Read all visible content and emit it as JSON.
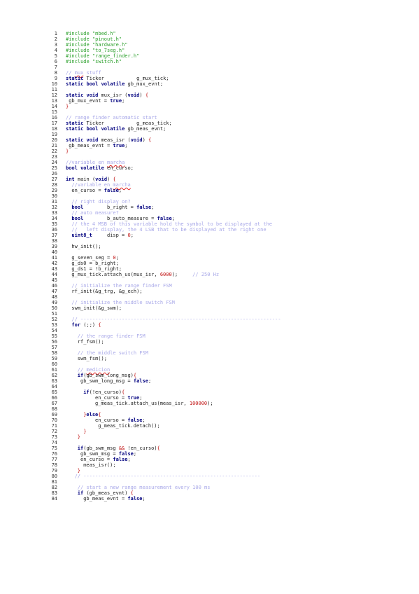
{
  "lines": [
    {
      "n": "1",
      "indent": 0,
      "tokens": [
        {
          "t": "c",
          "v": "#include \"mbed.h\""
        }
      ]
    },
    {
      "n": "2",
      "indent": 0,
      "tokens": [
        {
          "t": "c",
          "v": "#include \"pinout.h\""
        }
      ]
    },
    {
      "n": "3",
      "indent": 0,
      "tokens": [
        {
          "t": "c",
          "v": "#include \"hardware.h\""
        }
      ]
    },
    {
      "n": "4",
      "indent": 0,
      "tokens": [
        {
          "t": "c",
          "v": "#include \"to_7seg.h\""
        }
      ]
    },
    {
      "n": "5",
      "indent": 0,
      "tokens": [
        {
          "t": "c",
          "v": "#include \"range_finder.h\""
        }
      ]
    },
    {
      "n": "6",
      "indent": 0,
      "tokens": [
        {
          "t": "c",
          "v": "#include \"switch.h\""
        }
      ]
    },
    {
      "n": "7",
      "indent": 0,
      "tokens": []
    },
    {
      "n": "8",
      "indent": 0,
      "tokens": [
        {
          "t": "cm",
          "v": "// "
        },
        {
          "t": "cmsq",
          "v": "mux"
        },
        {
          "t": "cm",
          "v": " stuff"
        }
      ]
    },
    {
      "n": "9",
      "indent": 0,
      "tokens": [
        {
          "t": "k",
          "v": "static"
        },
        {
          "t": "n",
          "v": " Ticker           g_mux_tick;"
        }
      ]
    },
    {
      "n": "10",
      "indent": 0,
      "tokens": [
        {
          "t": "k",
          "v": "static bool volatile"
        },
        {
          "t": "n",
          "v": " gb_mux_evnt;"
        }
      ]
    },
    {
      "n": "11",
      "indent": 0,
      "tokens": []
    },
    {
      "n": "12",
      "indent": 0,
      "tokens": [
        {
          "t": "k",
          "v": "static void"
        },
        {
          "t": "n",
          "v": " mux_isr ("
        },
        {
          "t": "k",
          "v": "void"
        },
        {
          "t": "n",
          "v": ") "
        },
        {
          "t": "p",
          "v": "{"
        }
      ]
    },
    {
      "n": "13",
      "indent": 1,
      "tokens": [
        {
          "t": "n",
          "v": "gb_mux_evnt = "
        },
        {
          "t": "k",
          "v": "true"
        },
        {
          "t": "n",
          "v": ";"
        }
      ]
    },
    {
      "n": "14",
      "indent": 0,
      "tokens": [
        {
          "t": "p",
          "v": "}"
        }
      ]
    },
    {
      "n": "15",
      "indent": 0,
      "tokens": []
    },
    {
      "n": "16",
      "indent": 0,
      "tokens": [
        {
          "t": "cm",
          "v": "// range finder automatic start"
        }
      ]
    },
    {
      "n": "17",
      "indent": 0,
      "tokens": [
        {
          "t": "k",
          "v": "static"
        },
        {
          "t": "n",
          "v": " Ticker           g_meas_tick;"
        }
      ]
    },
    {
      "n": "18",
      "indent": 0,
      "tokens": [
        {
          "t": "k",
          "v": "static bool volatile"
        },
        {
          "t": "n",
          "v": " gb_meas_evnt;"
        }
      ]
    },
    {
      "n": "19",
      "indent": 0,
      "tokens": []
    },
    {
      "n": "20",
      "indent": 0,
      "tokens": [
        {
          "t": "k",
          "v": "static void"
        },
        {
          "t": "n",
          "v": " meas_isr ("
        },
        {
          "t": "k",
          "v": "void"
        },
        {
          "t": "n",
          "v": ") "
        },
        {
          "t": "p",
          "v": "{"
        }
      ]
    },
    {
      "n": "21",
      "indent": 1,
      "tokens": [
        {
          "t": "n",
          "v": "gb_meas_evnt = "
        },
        {
          "t": "k",
          "v": "true"
        },
        {
          "t": "n",
          "v": ";"
        }
      ]
    },
    {
      "n": "22",
      "indent": 0,
      "tokens": [
        {
          "t": "p",
          "v": "}"
        }
      ]
    },
    {
      "n": "23",
      "indent": 0,
      "tokens": []
    },
    {
      "n": "24",
      "indent": 0,
      "tokens": [
        {
          "t": "cm",
          "v": "//variable en "
        },
        {
          "t": "cmsq",
          "v": "marcha"
        }
      ]
    },
    {
      "n": "25",
      "indent": 0,
      "tokens": [
        {
          "t": "k",
          "v": "bool volatile"
        },
        {
          "t": "n",
          "v": " en_curso;"
        }
      ]
    },
    {
      "n": "26",
      "indent": 0,
      "tokens": []
    },
    {
      "n": "27",
      "indent": 0,
      "tokens": [
        {
          "t": "k",
          "v": "int"
        },
        {
          "t": "n",
          "v": " main ("
        },
        {
          "t": "k",
          "v": "void"
        },
        {
          "t": "n",
          "v": ") "
        },
        {
          "t": "p",
          "v": "{"
        }
      ]
    },
    {
      "n": "28",
      "indent": 2,
      "tokens": [
        {
          "t": "cm",
          "v": "//variable en "
        },
        {
          "t": "cmsq",
          "v": "marcha"
        }
      ]
    },
    {
      "n": "29",
      "indent": 2,
      "tokens": [
        {
          "t": "n",
          "v": "en_curso = "
        },
        {
          "t": "k",
          "v": "false"
        },
        {
          "t": "n",
          "v": ";"
        }
      ]
    },
    {
      "n": "30",
      "indent": 0,
      "tokens": []
    },
    {
      "n": "31",
      "indent": 2,
      "tokens": [
        {
          "t": "cm",
          "v": "// right display on?"
        }
      ]
    },
    {
      "n": "32",
      "indent": 2,
      "tokens": [
        {
          "t": "k",
          "v": "bool"
        },
        {
          "t": "n",
          "v": "        b_right = "
        },
        {
          "t": "k",
          "v": "false"
        },
        {
          "t": "n",
          "v": ";"
        }
      ]
    },
    {
      "n": "33",
      "indent": 2,
      "tokens": [
        {
          "t": "cm",
          "v": "// auto measure?"
        }
      ]
    },
    {
      "n": "34",
      "indent": 2,
      "tokens": [
        {
          "t": "k",
          "v": "bool"
        },
        {
          "t": "n",
          "v": "        b_auto_measure = "
        },
        {
          "t": "k",
          "v": "false"
        },
        {
          "t": "n",
          "v": ";"
        }
      ]
    },
    {
      "n": "35",
      "indent": 2,
      "tokens": [
        {
          "t": "cm",
          "v": "// the 4 MSB of this variable hold the symbol to be displayed at the"
        }
      ]
    },
    {
      "n": "36",
      "indent": 2,
      "tokens": [
        {
          "t": "cm",
          "v": "//   left display, the 4 LSB that to be displayed at the right one"
        }
      ]
    },
    {
      "n": "37",
      "indent": 2,
      "tokens": [
        {
          "t": "k",
          "v": "uint8_t"
        },
        {
          "t": "n",
          "v": "     disp = "
        },
        {
          "t": "s",
          "v": "0"
        },
        {
          "t": "n",
          "v": ";"
        }
      ]
    },
    {
      "n": "38",
      "indent": 0,
      "tokens": []
    },
    {
      "n": "39",
      "indent": 2,
      "tokens": [
        {
          "t": "n",
          "v": "hw_init();"
        }
      ]
    },
    {
      "n": "40",
      "indent": 0,
      "tokens": []
    },
    {
      "n": "41",
      "indent": 2,
      "tokens": [
        {
          "t": "n",
          "v": "g_seven_seg = "
        },
        {
          "t": "s",
          "v": "0"
        },
        {
          "t": "n",
          "v": ";"
        }
      ]
    },
    {
      "n": "42",
      "indent": 2,
      "tokens": [
        {
          "t": "n",
          "v": "g_ds0 = b_right;"
        }
      ]
    },
    {
      "n": "43",
      "indent": 2,
      "tokens": [
        {
          "t": "n",
          "v": "g_ds1 = !b_right;"
        }
      ]
    },
    {
      "n": "44",
      "indent": 2,
      "tokens": [
        {
          "t": "n",
          "v": "g_mux_tick.attach_us(mux_isr, "
        },
        {
          "t": "s",
          "v": "6000"
        },
        {
          "t": "n",
          "v": ");     "
        },
        {
          "t": "cm",
          "v": "// 250 Hz"
        }
      ]
    },
    {
      "n": "45",
      "indent": 0,
      "tokens": []
    },
    {
      "n": "46",
      "indent": 2,
      "tokens": [
        {
          "t": "cm",
          "v": "// initialize the range finder FSM"
        }
      ]
    },
    {
      "n": "47",
      "indent": 2,
      "tokens": [
        {
          "t": "n",
          "v": "rf_init(&g_trg, &g_ech);"
        }
      ]
    },
    {
      "n": "48",
      "indent": 0,
      "tokens": []
    },
    {
      "n": "49",
      "indent": 2,
      "tokens": [
        {
          "t": "cm",
          "v": "// initialize the middle switch FSM"
        }
      ]
    },
    {
      "n": "50",
      "indent": 2,
      "tokens": [
        {
          "t": "n",
          "v": "swm_init(&g_swm);"
        }
      ]
    },
    {
      "n": "51",
      "indent": 0,
      "tokens": []
    },
    {
      "n": "52",
      "indent": 2,
      "tokens": [
        {
          "t": "cm",
          "v": "// --------------------------------------------------------------------"
        }
      ]
    },
    {
      "n": "53",
      "indent": 2,
      "tokens": [
        {
          "t": "k",
          "v": "for"
        },
        {
          "t": "n",
          "v": " (;;) "
        },
        {
          "t": "p",
          "v": "{"
        }
      ]
    },
    {
      "n": "54",
      "indent": 0,
      "tokens": []
    },
    {
      "n": "55",
      "indent": 4,
      "tokens": [
        {
          "t": "cm",
          "v": "// the range finder FSM"
        }
      ]
    },
    {
      "n": "56",
      "indent": 4,
      "tokens": [
        {
          "t": "n",
          "v": "rf_fsm();"
        }
      ]
    },
    {
      "n": "57",
      "indent": 0,
      "tokens": []
    },
    {
      "n": "58",
      "indent": 4,
      "tokens": [
        {
          "t": "cm",
          "v": "// the middle switch FSM"
        }
      ]
    },
    {
      "n": "59",
      "indent": 4,
      "tokens": [
        {
          "t": "n",
          "v": "swm_fsm();"
        }
      ]
    },
    {
      "n": "60",
      "indent": 0,
      "tokens": []
    },
    {
      "n": "61",
      "indent": 4,
      "tokens": [
        {
          "t": "cm",
          "v": "// "
        },
        {
          "t": "cmsq",
          "v": "medicion"
        }
      ]
    },
    {
      "n": "62",
      "indent": 4,
      "tokens": [
        {
          "t": "k",
          "v": "if"
        },
        {
          "t": "n",
          "v": "(gb_swm_long_msg)"
        },
        {
          "t": "p",
          "v": "{"
        }
      ]
    },
    {
      "n": "63",
      "indent": 5,
      "tokens": [
        {
          "t": "n",
          "v": "gb_swm_long_msg = "
        },
        {
          "t": "k",
          "v": "false"
        },
        {
          "t": "n",
          "v": ";"
        }
      ]
    },
    {
      "n": "64",
      "indent": 0,
      "tokens": []
    },
    {
      "n": "65",
      "indent": 6,
      "tokens": [
        {
          "t": "k",
          "v": "if"
        },
        {
          "t": "n",
          "v": "(!en_curso)"
        },
        {
          "t": "p",
          "v": "{"
        }
      ]
    },
    {
      "n": "66",
      "indent": 10,
      "tokens": [
        {
          "t": "n",
          "v": "en_curso = "
        },
        {
          "t": "k",
          "v": "true"
        },
        {
          "t": "n",
          "v": ";"
        }
      ]
    },
    {
      "n": "67",
      "indent": 10,
      "tokens": [
        {
          "t": "n",
          "v": "g_meas_tick.attach_us(meas_isr, "
        },
        {
          "t": "s",
          "v": "100000"
        },
        {
          "t": "n",
          "v": ");"
        }
      ]
    },
    {
      "n": "68",
      "indent": 0,
      "tokens": []
    },
    {
      "n": "69",
      "indent": 6,
      "tokens": [
        {
          "t": "p",
          "v": "}"
        },
        {
          "t": "k",
          "v": "else"
        },
        {
          "t": "p",
          "v": "{"
        }
      ]
    },
    {
      "n": "70",
      "indent": 10,
      "tokens": [
        {
          "t": "n",
          "v": "en_curso = "
        },
        {
          "t": "k",
          "v": "false"
        },
        {
          "t": "n",
          "v": ";"
        }
      ]
    },
    {
      "n": "71",
      "indent": 11,
      "tokens": [
        {
          "t": "n",
          "v": "g_meas_tick.detach();"
        }
      ]
    },
    {
      "n": "72",
      "indent": 6,
      "tokens": [
        {
          "t": "p",
          "v": "}"
        }
      ]
    },
    {
      "n": "73",
      "indent": 4,
      "tokens": [
        {
          "t": "p",
          "v": "}"
        }
      ]
    },
    {
      "n": "74",
      "indent": 0,
      "tokens": []
    },
    {
      "n": "75",
      "indent": 4,
      "tokens": [
        {
          "t": "k",
          "v": "if"
        },
        {
          "t": "n",
          "v": "(gb_swm_msg "
        },
        {
          "t": "s",
          "v": "&&"
        },
        {
          "t": "n",
          "v": " !en_curso)"
        },
        {
          "t": "p",
          "v": "{"
        }
      ]
    },
    {
      "n": "76",
      "indent": 5,
      "tokens": [
        {
          "t": "n",
          "v": "gb_swm_msg = "
        },
        {
          "t": "k",
          "v": "false"
        },
        {
          "t": "n",
          "v": ";"
        }
      ]
    },
    {
      "n": "77",
      "indent": 5,
      "tokens": [
        {
          "t": "n",
          "v": "en_curso = "
        },
        {
          "t": "k",
          "v": "false"
        },
        {
          "t": "n",
          "v": ";"
        }
      ]
    },
    {
      "n": "78",
      "indent": 6,
      "tokens": [
        {
          "t": "n",
          "v": "meas_isr();"
        }
      ]
    },
    {
      "n": "79",
      "indent": 4,
      "tokens": [
        {
          "t": "p",
          "v": "}"
        }
      ]
    },
    {
      "n": "80",
      "indent": 3,
      "tokens": [
        {
          "t": "cm",
          "v": "// ------------------------------------------------------------"
        }
      ]
    },
    {
      "n": "81",
      "indent": 0,
      "tokens": []
    },
    {
      "n": "82",
      "indent": 4,
      "tokens": [
        {
          "t": "cm",
          "v": "// start a new range measurement every 100 ms"
        }
      ]
    },
    {
      "n": "83",
      "indent": 4,
      "tokens": [
        {
          "t": "k",
          "v": "if"
        },
        {
          "t": "n",
          "v": " (gb_meas_evnt) "
        },
        {
          "t": "p",
          "v": "{"
        }
      ]
    },
    {
      "n": "84",
      "indent": 6,
      "tokens": [
        {
          "t": "n",
          "v": "gb_meas_evnt = "
        },
        {
          "t": "k",
          "v": "false"
        },
        {
          "t": "n",
          "v": ";"
        }
      ]
    }
  ]
}
